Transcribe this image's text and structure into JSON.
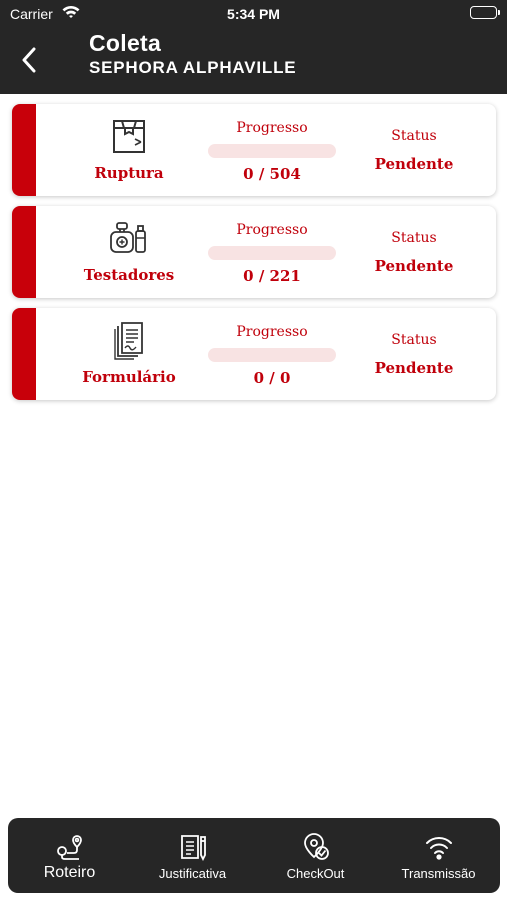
{
  "status_bar": {
    "carrier": "Carrier",
    "time": "5:34 PM"
  },
  "header": {
    "title": "Coleta",
    "subtitle": "SEPHORA ALPHAVILLE"
  },
  "colors": {
    "accent": "#c8000a",
    "bar": "#262626",
    "progress_track": "#f8e3e3"
  },
  "cards": [
    {
      "icon": "box-icon",
      "name": "Ruptura",
      "progress_label": "Progresso",
      "progress_count": "0 / 504",
      "progress_fraction": 0,
      "status_label": "Status",
      "status_value": "Pendente"
    },
    {
      "icon": "perfume-bottles-icon",
      "name": "Testadores",
      "progress_label": "Progresso",
      "progress_count": "0 / 221",
      "progress_fraction": 0,
      "status_label": "Status",
      "status_value": "Pendente"
    },
    {
      "icon": "documents-icon",
      "name": "Formulário",
      "progress_label": "Progresso",
      "progress_count": "0 / 0",
      "progress_fraction": 0,
      "status_label": "Status",
      "status_value": "Pendente"
    }
  ],
  "tabbar": {
    "tabs": [
      {
        "label": "Roteiro",
        "icon": "route-icon",
        "active": true
      },
      {
        "label": "Justificativa",
        "icon": "justification-icon",
        "active": false
      },
      {
        "label": "CheckOut",
        "icon": "checkout-pin-icon",
        "active": false
      },
      {
        "label": "Transmissão",
        "icon": "wifi-icon",
        "active": false
      }
    ]
  }
}
